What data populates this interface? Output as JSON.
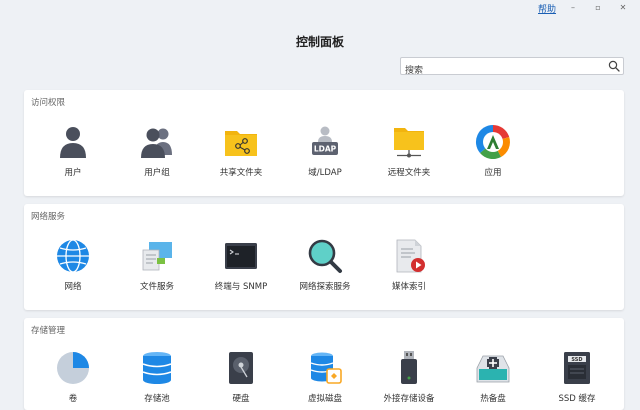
{
  "header": {
    "help_label": "帮助",
    "minimize_label": "–",
    "maximize_label": "▫",
    "close_label": "✕",
    "page_title": "控制面板"
  },
  "search": {
    "placeholder": "搜索",
    "value": ""
  },
  "sections": [
    {
      "title": "访问权限",
      "items": [
        {
          "label": "用户",
          "icon": "user-icon"
        },
        {
          "label": "用户组",
          "icon": "user-group-icon"
        },
        {
          "label": "共享文件夹",
          "icon": "shared-folder-icon"
        },
        {
          "label": "域/LDAP",
          "icon": "ldap-icon"
        },
        {
          "label": "远程文件夹",
          "icon": "remote-folder-icon"
        },
        {
          "label": "应用",
          "icon": "app-icon"
        }
      ]
    },
    {
      "title": "网络服务",
      "items": [
        {
          "label": "网络",
          "icon": "globe-icon"
        },
        {
          "label": "文件服务",
          "icon": "file-service-icon"
        },
        {
          "label": "终端与 SNMP",
          "icon": "terminal-icon"
        },
        {
          "label": "网络探索服务",
          "icon": "network-discovery-icon"
        },
        {
          "label": "媒体索引",
          "icon": "media-index-icon"
        }
      ]
    },
    {
      "title": "存储管理",
      "items": [
        {
          "label": "卷",
          "icon": "volume-icon"
        },
        {
          "label": "存储池",
          "icon": "storage-pool-icon"
        },
        {
          "label": "硬盘",
          "icon": "hard-disk-icon"
        },
        {
          "label": "虚拟磁盘",
          "icon": "virtual-disk-icon"
        },
        {
          "label": "外接存储设备",
          "icon": "usb-drive-icon"
        },
        {
          "label": "热备盘",
          "icon": "hot-spare-icon"
        },
        {
          "label": "SSD 缓存",
          "icon": "ssd-cache-icon",
          "chip_text": "SSD"
        }
      ]
    }
  ],
  "colors": {
    "background": "#eef1f5",
    "link": "#1a5fb4",
    "folder_yellow": "#f7c21c",
    "blue": "#1e88e5",
    "teal": "#2bb3b0"
  }
}
